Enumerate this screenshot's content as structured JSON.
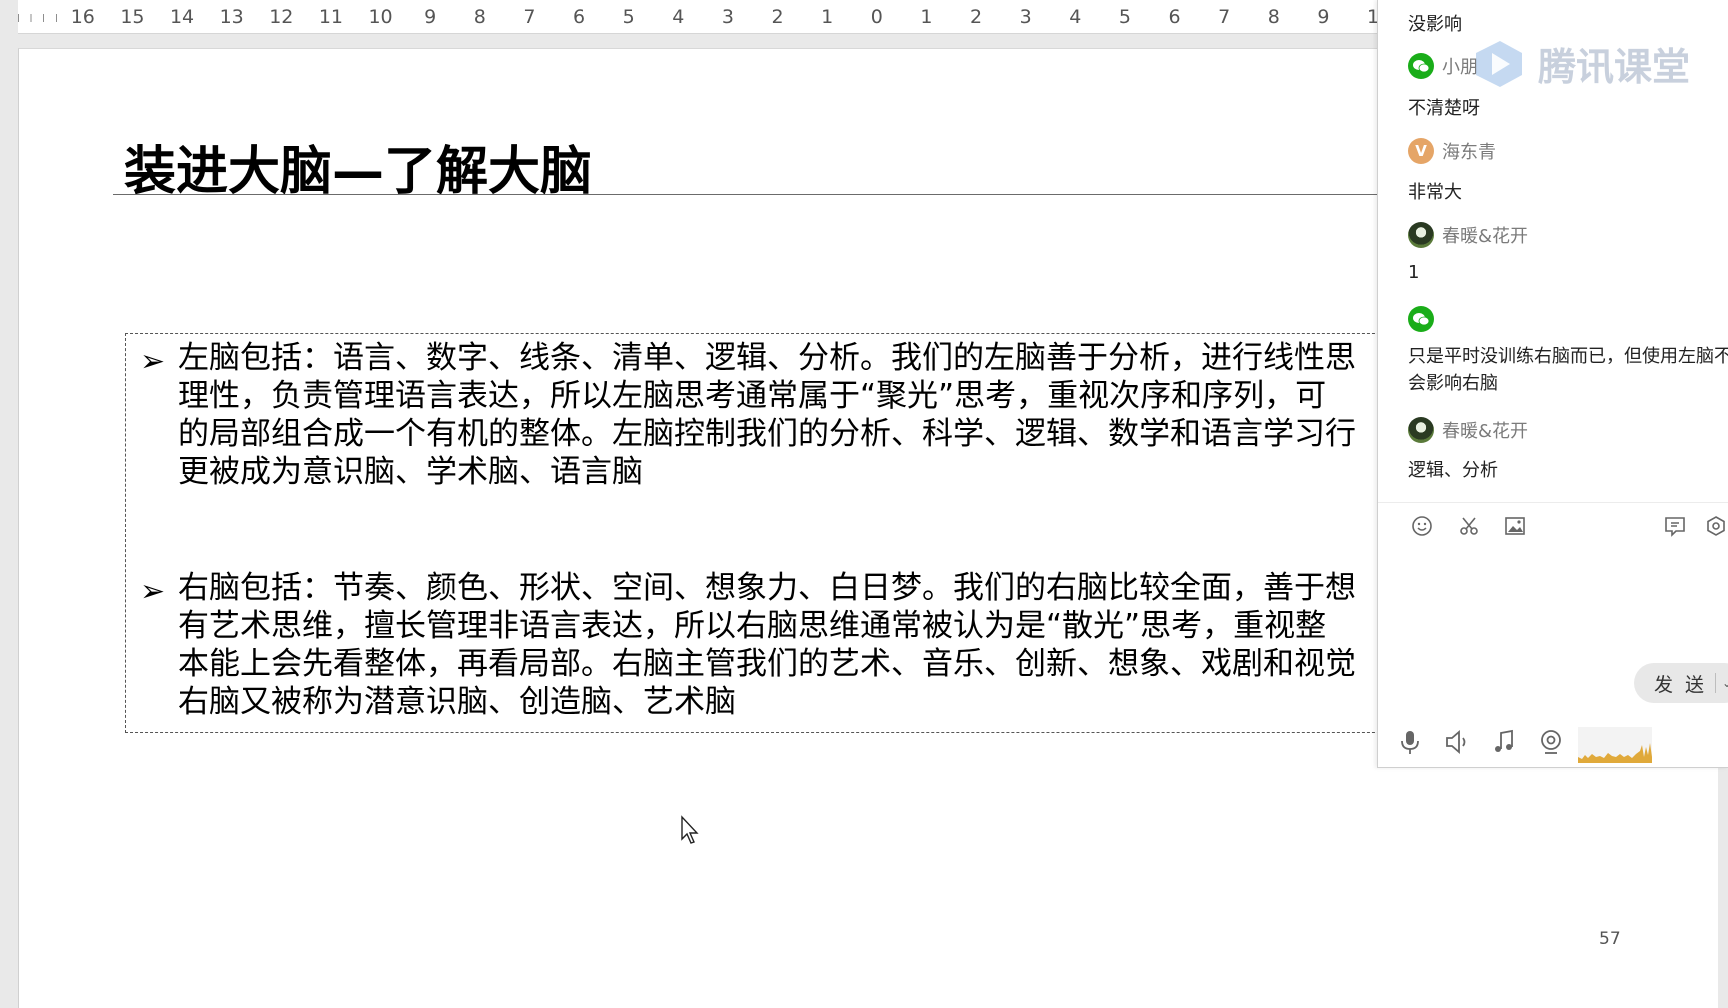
{
  "ruler": {
    "labels": [
      "16",
      "15",
      "14",
      "13",
      "12",
      "11",
      "10",
      "9",
      "8",
      "7",
      "6",
      "5",
      "4",
      "3",
      "2",
      "1",
      "0",
      "1",
      "2",
      "3",
      "4",
      "5",
      "6",
      "7",
      "8",
      "9",
      "1"
    ]
  },
  "slide": {
    "title": "装进大脑—了解大脑",
    "left_brain_lines": [
      "左脑包括：语言、数字、线条、清单、逻辑、分析。我们的左脑善于分析，进行线性思",
      "理性，负责管理语言表达，所以左脑思考通常属于“聚光”思考，重视次序和序列，可",
      "的局部组合成一个有机的整体。左脑控制我们的分析、科学、逻辑、数学和语言学习行",
      "更被成为意识脑、学术脑、语言脑"
    ],
    "right_brain_lines": [
      "右脑包括：节奏、颜色、形状、空间、想象力、白日梦。我们的右脑比较全面，善于想",
      "有艺术思维，擅长管理非语言表达，所以右脑思维通常被认为是“散光”思考，重视整",
      "本能上会先看整体，再看局部。右脑主管我们的艺术、音乐、创新、想象、戏剧和视觉",
      "右脑又被称为潜意识脑、创造脑、艺术脑"
    ],
    "bullet_glyph": "➢",
    "page_number": "57"
  },
  "chat": {
    "watermark": "腾讯课堂",
    "messages": [
      {
        "text": "没影响"
      },
      {
        "user": "小朋",
        "avatar": "wechat"
      },
      {
        "text": "不清楚呀"
      },
      {
        "user": "海东青",
        "avatar": "v",
        "initial": "V"
      },
      {
        "text": "非常大"
      },
      {
        "user": "春暖&花开",
        "avatar": "photo"
      },
      {
        "text": "1"
      },
      {
        "user": "",
        "avatar": "wechat"
      },
      {
        "text": "只是平时没训练右脑而已，但使用左脑不会影响右脑"
      },
      {
        "user": "春暖&花开",
        "avatar": "photo"
      },
      {
        "text": "逻辑、分析"
      }
    ],
    "send_label": "发 送",
    "toolbar_icons": [
      "emoji-icon",
      "scissors-icon",
      "image-icon",
      "comment-icon",
      "settings-icon"
    ],
    "bottom_icons": [
      "microphone-icon",
      "speaker-icon",
      "music-icon",
      "camera-icon"
    ],
    "colors": {
      "wechat_green": "#1aad19",
      "v_avatar": "#e5a567"
    }
  }
}
